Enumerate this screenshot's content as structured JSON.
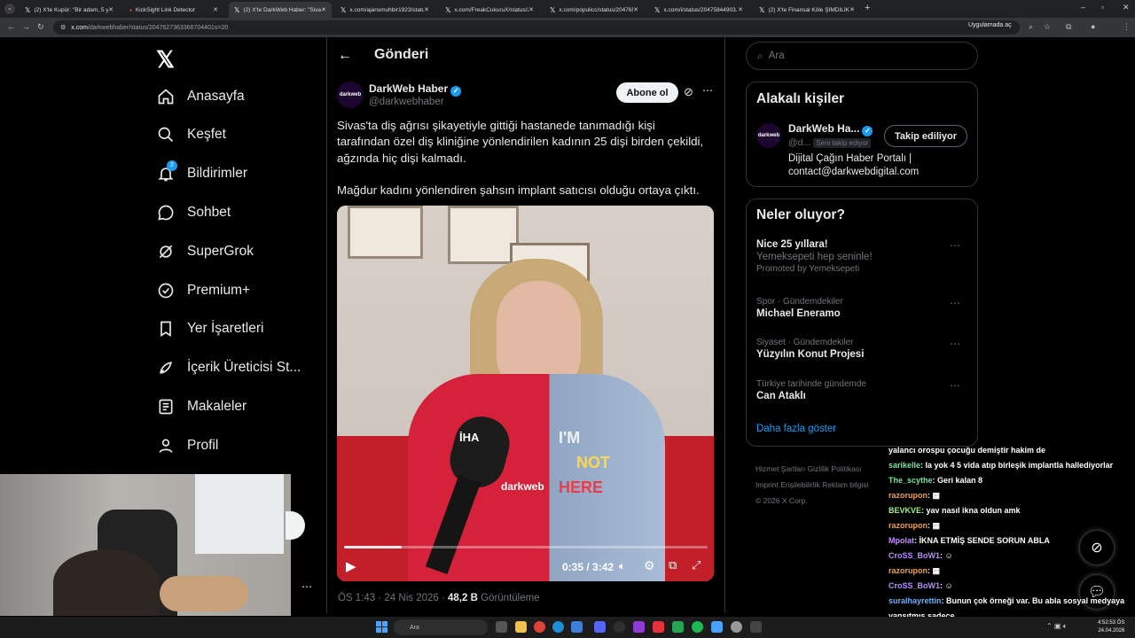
{
  "browser": {
    "tabs": [
      {
        "label": "(2) X'te Kupür: \"Bir adam, 5 yıldır...",
        "active": false
      },
      {
        "label": "KickSight Link Detector",
        "active": false
      },
      {
        "label": "(2) X'te DarkWeb Haber: \"Sivas'ta...",
        "active": true
      },
      {
        "label": "x.com/ajansmuhbir1923/status...",
        "active": false
      },
      {
        "label": "x.com/FreakCukuruX/status/20...",
        "active": false
      },
      {
        "label": "x.com/populicc/status/204765...",
        "active": false
      },
      {
        "label": "x.com/i/status/20475844903...",
        "active": false
      },
      {
        "label": "(2) X'te Finansal Köle ŞİMDİLİK...",
        "active": false
      }
    ],
    "url_domain": "x.com",
    "url_path": "/darkwebhaber/status/2047627363366704401s=20",
    "app_badge": "Uygulamada aç"
  },
  "nav": {
    "items": [
      {
        "label": "Anasayfa",
        "icon": "home-icon"
      },
      {
        "label": "Keşfet",
        "icon": "search-icon"
      },
      {
        "label": "Bildirimler",
        "icon": "bell-icon",
        "badge": "2"
      },
      {
        "label": "Sohbet",
        "icon": "chat-icon"
      },
      {
        "label": "SuperGrok",
        "icon": "grok-icon"
      },
      {
        "label": "Premium+",
        "icon": "verified-icon"
      },
      {
        "label": "Yer İşaretleri",
        "icon": "bookmark-icon"
      },
      {
        "label": "İçerik Üreticisi St...",
        "icon": "rocket-icon"
      },
      {
        "label": "Makaleler",
        "icon": "article-icon"
      },
      {
        "label": "Profil",
        "icon": "person-icon"
      }
    ]
  },
  "header": {
    "title": "Gönderi"
  },
  "tweet": {
    "author_name": "DarkWeb Haber",
    "author_handle": "@darkwebhaber",
    "avatar_text": "darkweb",
    "subscribe_label": "Abone ol",
    "text_1": "Sivas'ta diş ağrısı şikayetiyle gittiği hastanede tanımadığı kişi tarafından özel diş kliniğine yönlendirilen kadının 25 dişi birden çekildi, ağzında hiç dişi kalmadı.",
    "text_2": "Mağdur kadını yönlendiren şahsın implant satıcısı olduğu ortaya çıktı.",
    "video": {
      "time": "0:35 / 3:42",
      "progress": 0.158,
      "shirt_text_1": "I'M",
      "shirt_text_2": "NOT",
      "shirt_text_3": "HERE",
      "mic_label": "İHA",
      "watermark": "darkweb"
    },
    "time": "ÖS 1:43 · 24 Nis 2026 · ",
    "views_count": "48,2 B",
    "views_label": " Görüntüleme"
  },
  "sidebar": {
    "search_placeholder": "Ara",
    "related_title": "Alakalı kişiler",
    "related_name": "DarkWeb Ha...",
    "related_handle": "@d...",
    "follows_you": "Seni takip ediyor",
    "follow_button": "Takip ediliyor",
    "related_bio": "Dijital Çağın Haber Portalı | contact@darkwebdigital.com",
    "trends_title": "Neler oluyor?",
    "trends": [
      {
        "category": "",
        "name": "Nice 25 yıllara!",
        "sub": "Yemeksepeti hep seninle!",
        "sub2": "Promoted by Yemeksepeti"
      },
      {
        "category": "Spor · Gündemdekiler",
        "name": "Michael Eneramo",
        "sub": "",
        "sub2": ""
      },
      {
        "category": "Siyaset · Gündemdekiler",
        "name": "Yüzyılın Konut Projesi",
        "sub": "",
        "sub2": ""
      },
      {
        "category": "Türkiye tarihinde gündemde",
        "name": "Can Ataklı",
        "sub": "",
        "sub2": ""
      }
    ],
    "show_more": "Daha fazla göster",
    "footer_1": "Hizmet Şartları   Gizlilik Politikası",
    "footer_2": "Imprint   Erişilebilirlik   Reklam bilgisi",
    "footer_3": "© 2026 X Corp."
  },
  "chat": [
    {
      "user": "",
      "color": "#ffffff",
      "msg": "yalancı orospu çocuğu demiştir hakim de"
    },
    {
      "user": "sarikelle",
      "color": "#7fe0a6",
      "msg": ": la yok 4 5 vida atıp birleşik implantla hallediyorlar"
    },
    {
      "user": "The_scythe",
      "color": "#7fe0a6",
      "msg": ": Geri kalan 8"
    },
    {
      "user": "razorupon",
      "color": "#f0a04b",
      "msg": ": ▦"
    },
    {
      "user": "BEVKVE",
      "color": "#9bf27c",
      "msg": ": yav nasıl ikna oldun amk"
    },
    {
      "user": "razorupon",
      "color": "#f0a04b",
      "msg": ": ▦"
    },
    {
      "user": "Mpolat",
      "color": "#c98cff",
      "msg": ": İKNA ETMİŞ SENDE SORUN ABLA"
    },
    {
      "user": "CroSS_BoW1",
      "color": "#b68cff",
      "msg": ": ☺"
    },
    {
      "user": "razorupon",
      "color": "#f0a04b",
      "msg": ": ▦"
    },
    {
      "user": "CroSS_BoW1",
      "color": "#b68cff",
      "msg": ": ☺"
    },
    {
      "user": "suralhayrettin",
      "color": "#6fb3ff",
      "msg": ": Bunun çok örneği var. Bu abla sosyal medyaya"
    },
    {
      "user": "",
      "color": "#ffffff",
      "msg": "yansıtmış sadece"
    }
  ],
  "taskbar": {
    "search": "Ara",
    "time": "4:52:53 ÖS",
    "date": "24.04.2026"
  },
  "colors": {
    "accent": "#1d9bf0",
    "bg": "#000000",
    "border": "#2f3336",
    "muted": "#71767b"
  }
}
